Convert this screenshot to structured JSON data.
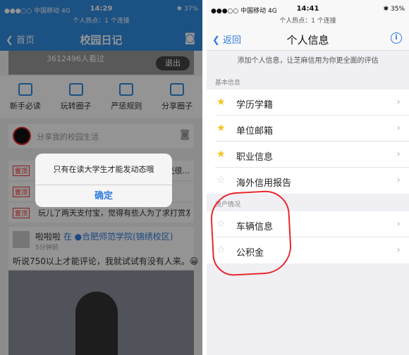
{
  "left": {
    "status": {
      "carrier": "●●●○○ 中国移动  4G",
      "time": "14:29",
      "battery": "✱ 37%",
      "hotspot": "个人热点：1 个连接"
    },
    "nav": {
      "back": "首页",
      "title": "校园日记"
    },
    "banner": {
      "views": "3612496人看过",
      "exit": "退出"
    },
    "quick": [
      "新手必读",
      "玩转圈子",
      "严惩规则",
      "分享圈子"
    ],
    "share_placeholder": "分享我的校园生活",
    "pinned": [
      {
        "tag": "置顶",
        "text": "光很..."
      },
      {
        "tag": "置顶",
        "text": ""
      },
      {
        "tag": "置顶",
        "text": "玩儿了两天支付宝，觉得有些人为了求打赏发很..."
      }
    ],
    "post": {
      "user": "啦啦啦",
      "location": "在 ●合肥师范学院(锦绣校区)",
      "time": "5分钟前",
      "text": "听说750以上才能评论，我就试试有没有人来。😀"
    },
    "dialog": {
      "message": "只有在读大学生才能发动态哦",
      "ok": "确定"
    }
  },
  "right": {
    "status": {
      "carrier": "●●●○○ 中国移动  4G",
      "time": "14:41",
      "battery": "✱ 35%",
      "hotspot": "个人热点：1 个连接"
    },
    "nav": {
      "back": "返回",
      "title": "个人信息"
    },
    "hint": "添加个人信息，让芝麻信用为你更全面的评估",
    "sections": [
      {
        "title": "基本信息",
        "rows": [
          {
            "label": "学历学籍",
            "star": "full"
          },
          {
            "label": "单位邮箱",
            "star": "full"
          },
          {
            "label": "职业信息",
            "star": "full"
          },
          {
            "label": "海外信用报告",
            "star": "empty"
          }
        ]
      },
      {
        "title": "资产情况",
        "rows": [
          {
            "label": "车辆信息",
            "star": "empty"
          },
          {
            "label": "公积金",
            "star": "empty"
          }
        ]
      }
    ]
  }
}
